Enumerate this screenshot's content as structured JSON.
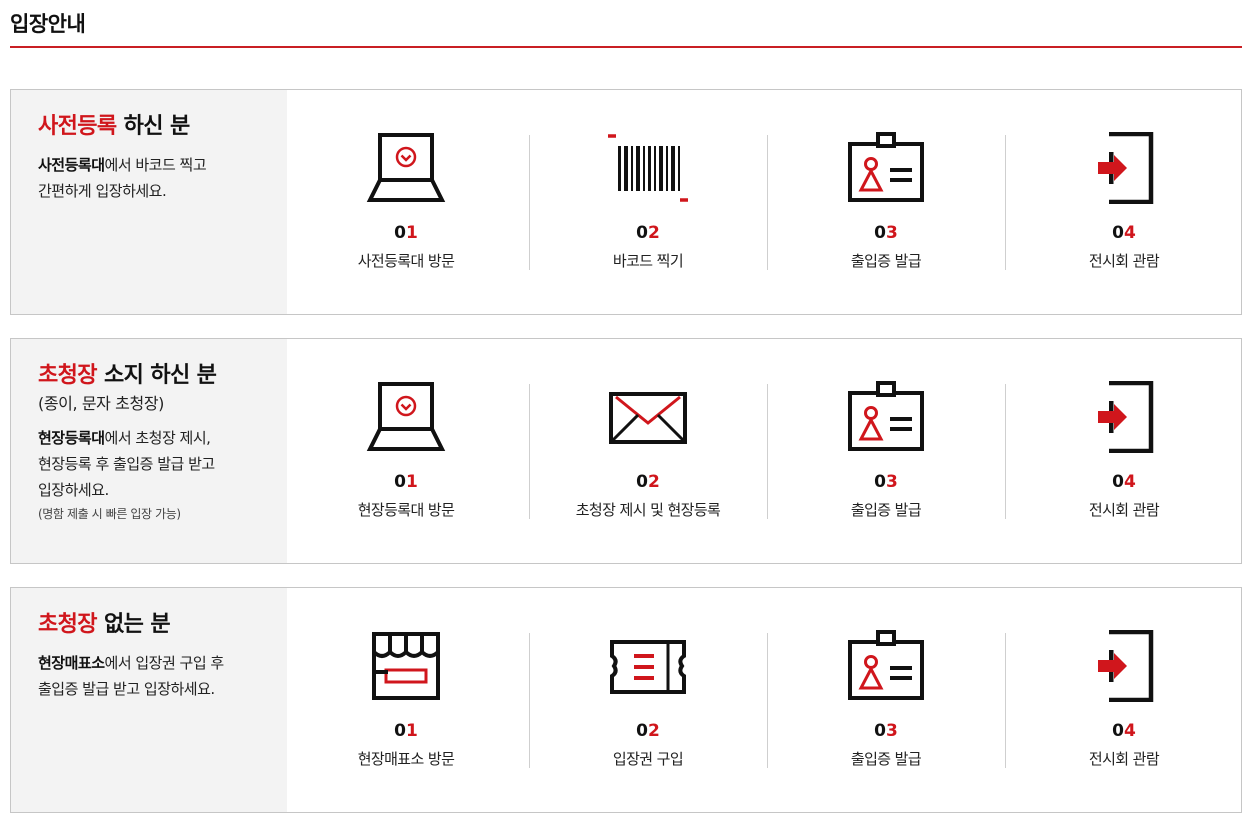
{
  "page": {
    "title": "입장안내"
  },
  "colors": {
    "accent": "#d0161c",
    "rule": "#c91f24",
    "panel_bg": "#f3f3f3"
  },
  "sections": [
    {
      "heading_highlight": "사전등록",
      "heading_rest": " 하신 분",
      "subheading": "",
      "desc_bold": "사전등록대",
      "desc_rest": "에서 바코드 찍고",
      "desc_line2": "간편하게 입장하세요.",
      "desc_line3": "",
      "note": "",
      "steps": [
        {
          "num_a": "0",
          "num_b": "1",
          "label": "사전등록대 방문",
          "icon": "laptop-icon"
        },
        {
          "num_a": "0",
          "num_b": "2",
          "label": "바코드 찍기",
          "icon": "barcode-icon"
        },
        {
          "num_a": "0",
          "num_b": "3",
          "label": "출입증 발급",
          "icon": "id-badge-icon"
        },
        {
          "num_a": "0",
          "num_b": "4",
          "label": "전시회 관람",
          "icon": "enter-door-icon"
        }
      ]
    },
    {
      "heading_highlight": "초청장",
      "heading_rest": " 소지 하신 분",
      "subheading": "(종이, 문자 초청장)",
      "desc_bold": "현장등록대",
      "desc_rest": "에서 초청장 제시,",
      "desc_line2": "현장등록 후 출입증 발급 받고",
      "desc_line3": "입장하세요.",
      "note": "(명함 제출 시 빠른 입장 가능)",
      "steps": [
        {
          "num_a": "0",
          "num_b": "1",
          "label": "현장등록대 방문",
          "icon": "laptop-icon"
        },
        {
          "num_a": "0",
          "num_b": "2",
          "label": "초청장 제시 및 현장등록",
          "icon": "envelope-icon"
        },
        {
          "num_a": "0",
          "num_b": "3",
          "label": "출입증 발급",
          "icon": "id-badge-icon"
        },
        {
          "num_a": "0",
          "num_b": "4",
          "label": "전시회 관람",
          "icon": "enter-door-icon"
        }
      ]
    },
    {
      "heading_highlight": "초청장",
      "heading_rest": " 없는 분",
      "subheading": "",
      "desc_bold": "현장매표소",
      "desc_rest": "에서 입장권 구입 후",
      "desc_line2": "출입증 발급 받고 입장하세요.",
      "desc_line3": "",
      "note": "",
      "steps": [
        {
          "num_a": "0",
          "num_b": "1",
          "label": "현장매표소 방문",
          "icon": "ticket-booth-icon"
        },
        {
          "num_a": "0",
          "num_b": "2",
          "label": "입장권 구입",
          "icon": "ticket-icon"
        },
        {
          "num_a": "0",
          "num_b": "3",
          "label": "출입증 발급",
          "icon": "id-badge-icon"
        },
        {
          "num_a": "0",
          "num_b": "4",
          "label": "전시회 관람",
          "icon": "enter-door-icon"
        }
      ]
    }
  ]
}
